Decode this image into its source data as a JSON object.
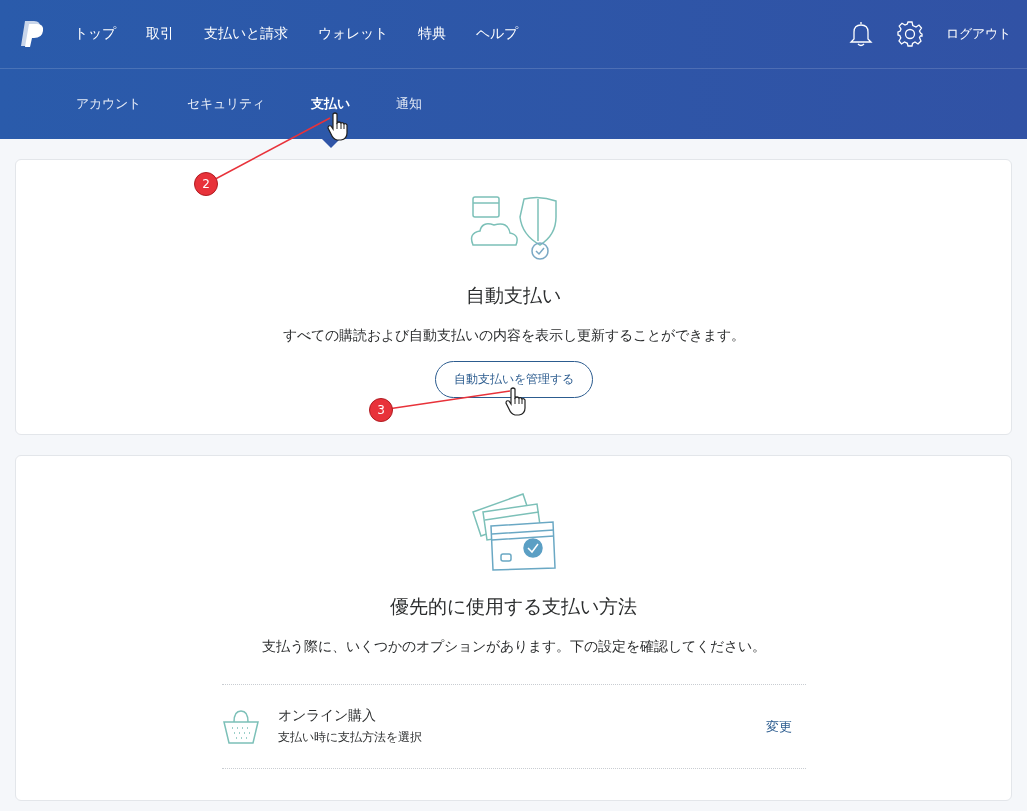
{
  "header": {
    "nav": [
      {
        "label": "トップ"
      },
      {
        "label": "取引"
      },
      {
        "label": "支払いと請求"
      },
      {
        "label": "ウォレット"
      },
      {
        "label": "特典"
      },
      {
        "label": "ヘルプ"
      }
    ],
    "logout": "ログアウト"
  },
  "subnav": [
    {
      "label": "アカウント",
      "selected": false
    },
    {
      "label": "セキュリティ",
      "selected": false
    },
    {
      "label": "支払い",
      "selected": true
    },
    {
      "label": "通知",
      "selected": false
    }
  ],
  "autopay": {
    "title": "自動支払い",
    "description": "すべての購読および自動支払いの内容を表示し更新することができます。",
    "button": "自動支払いを管理する"
  },
  "preferred": {
    "title": "優先的に使用する支払い方法",
    "description": "支払う際に、いくつかのオプションがあります。下の設定を確認してください。",
    "rows": [
      {
        "title": "オンライン購入",
        "subtitle": "支払い時に支払方法を選択",
        "action": "変更"
      }
    ]
  },
  "annotations": [
    {
      "number": "2"
    },
    {
      "number": "3"
    }
  ]
}
